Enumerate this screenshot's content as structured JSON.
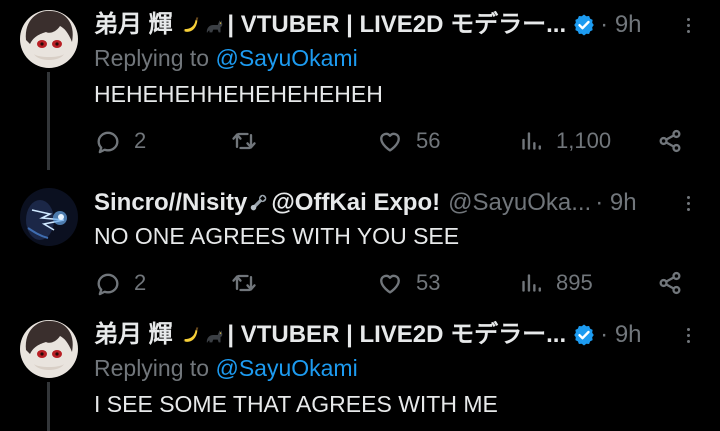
{
  "tweets": [
    {
      "author_name": "弟月 輝",
      "author_name_rest": "| VTUBER | LIVE2D モデラー...",
      "author_emojis": [
        "banana-emoji",
        "black-cat-emoji"
      ],
      "verified": true,
      "handle": "",
      "time_sep": "·",
      "time": "9h",
      "replying_prefix": "Replying to",
      "replying_to": "@SayuOkami",
      "text": "HEHEHEHHEHEHEHEHEH",
      "replies": "2",
      "retweets": "",
      "likes": "56",
      "views": "1,100"
    },
    {
      "author_name": "Sincro//Nisity",
      "author_name_rest": "@OffKai Expo!",
      "author_emojis": [
        "wrench-nut-emoji"
      ],
      "verified": false,
      "handle": "@SayuOka...",
      "time_sep": "·",
      "time": "9h",
      "replying_prefix": "",
      "replying_to": "",
      "text": "NO ONE AGREES WITH YOU SEE",
      "replies": "2",
      "retweets": "",
      "likes": "53",
      "views": "895"
    },
    {
      "author_name": "弟月 輝",
      "author_name_rest": "| VTUBER | LIVE2D モデラー...",
      "author_emojis": [
        "banana-emoji",
        "black-cat-emoji"
      ],
      "verified": true,
      "handle": "",
      "time_sep": "·",
      "time": "9h",
      "replying_prefix": "Replying to",
      "replying_to": "@SayuOkami",
      "text": "I SEE SOME THAT AGREES WITH ME"
    }
  ],
  "icons": {
    "reply": "reply-icon",
    "retweet": "retweet-icon",
    "like": "heart-icon",
    "views": "views-chart-icon",
    "share": "share-icon",
    "more": "more-dots-icon",
    "verified": "verified-badge-icon"
  },
  "colors": {
    "background": "#000000",
    "text": "#e7e9ea",
    "muted": "#71767b",
    "accent": "#1d9bf0",
    "thread_line": "#333639"
  }
}
